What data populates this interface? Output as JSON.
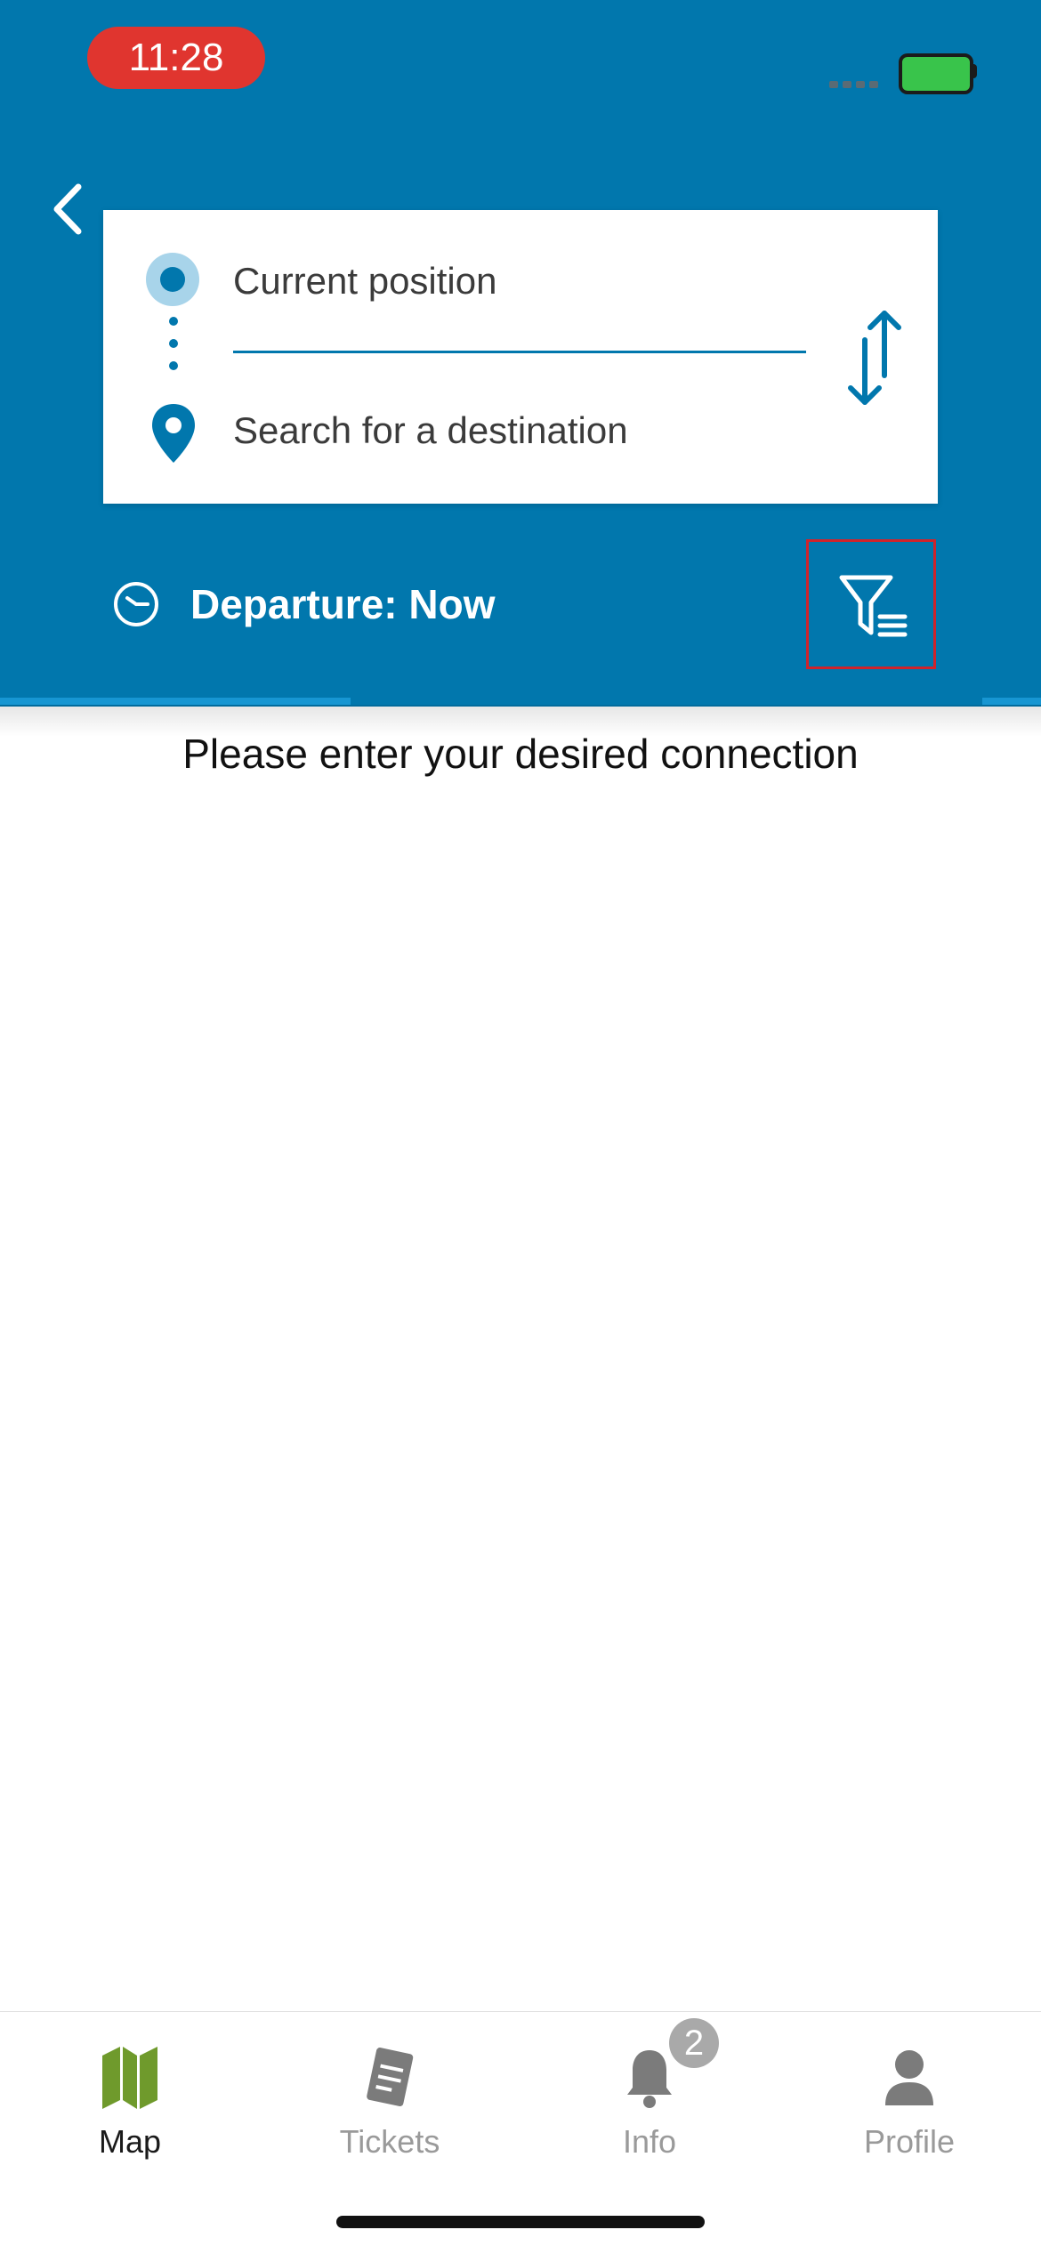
{
  "status_bar": {
    "time": "11:28"
  },
  "search": {
    "origin_label": "Current position",
    "destination_placeholder": "Search for a destination"
  },
  "departure": {
    "label": "Departure: Now"
  },
  "hint": "Please enter your desired connection",
  "tabs": [
    {
      "label": "Map",
      "icon": "map-icon",
      "active": true
    },
    {
      "label": "Tickets",
      "icon": "ticket-icon",
      "active": false
    },
    {
      "label": "Info",
      "icon": "bell-icon",
      "active": false,
      "badge": "2"
    },
    {
      "label": "Profile",
      "icon": "person-icon",
      "active": false
    }
  ],
  "colors": {
    "header_bg": "#0177ad",
    "accent": "#0177ad",
    "time_pill": "#e0352f",
    "map_icon": "#6f9a2c",
    "highlight_border": "#d0232b"
  }
}
